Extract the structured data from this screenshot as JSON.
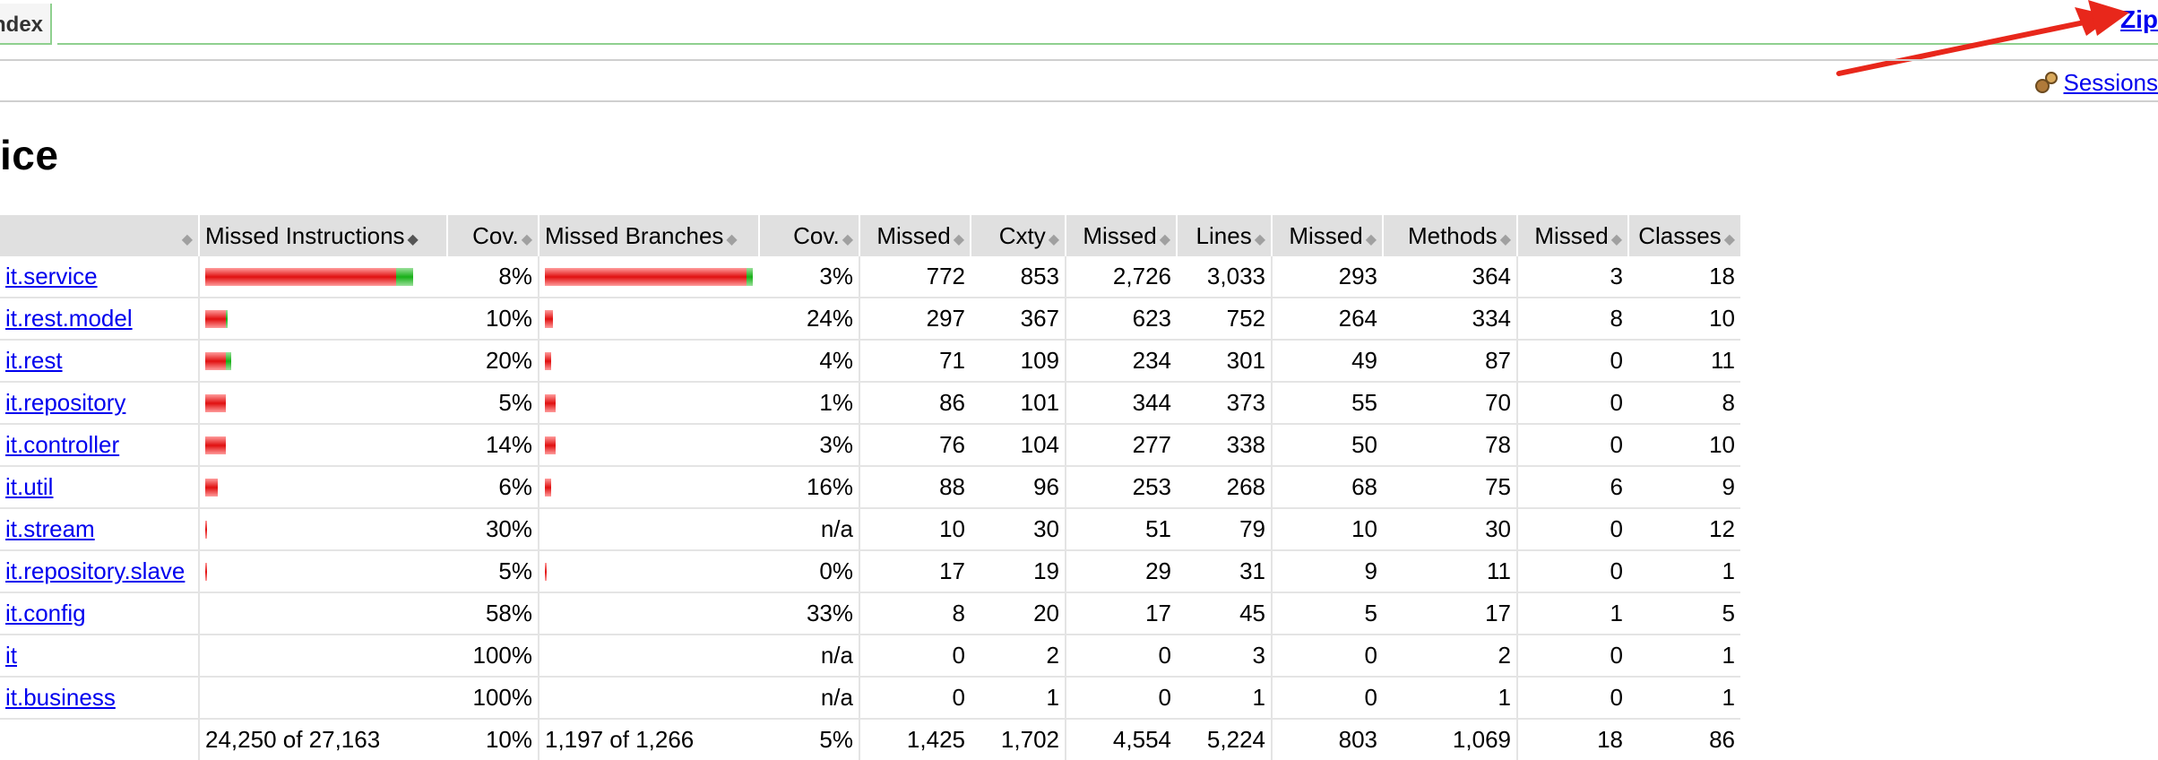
{
  "header": {
    "tab_label": "ndex",
    "zip_link": "Zip",
    "sessions_link": "Sessions"
  },
  "title": "ice",
  "table": {
    "columns": [
      "",
      "Missed Instructions",
      "Cov.",
      "Missed Branches",
      "Cov.",
      "Missed",
      "Cxty",
      "Missed",
      "Lines",
      "Missed",
      "Methods",
      "Missed",
      "Classes"
    ],
    "rows": [
      {
        "name": "it.service",
        "ins_red": 0.92,
        "ins_green": 0.08,
        "ins_cov": "8%",
        "br_red": 0.97,
        "br_green": 0.03,
        "br_cov": "3%",
        "cx_missed": "772",
        "cxty": "853",
        "ln_missed": "2,726",
        "lines": "3,033",
        "mt_missed": "293",
        "methods": "364",
        "cl_missed": "3",
        "classes": "18"
      },
      {
        "name": "it.rest.model",
        "ins_red": 0.1,
        "ins_green": 0.01,
        "ins_cov": "10%",
        "br_red": 0.04,
        "br_green": 0.0,
        "br_cov": "24%",
        "cx_missed": "297",
        "cxty": "367",
        "ln_missed": "623",
        "lines": "752",
        "mt_missed": "264",
        "methods": "334",
        "cl_missed": "8",
        "classes": "10"
      },
      {
        "name": "it.rest",
        "ins_red": 0.1,
        "ins_green": 0.025,
        "ins_cov": "20%",
        "br_red": 0.03,
        "br_green": 0.0,
        "br_cov": "4%",
        "cx_missed": "71",
        "cxty": "109",
        "ln_missed": "234",
        "lines": "301",
        "mt_missed": "49",
        "methods": "87",
        "cl_missed": "0",
        "classes": "11"
      },
      {
        "name": "it.repository",
        "ins_red": 0.1,
        "ins_green": 0.0,
        "ins_cov": "5%",
        "br_red": 0.05,
        "br_green": 0.0,
        "br_cov": "1%",
        "cx_missed": "86",
        "cxty": "101",
        "ln_missed": "344",
        "lines": "373",
        "mt_missed": "55",
        "methods": "70",
        "cl_missed": "0",
        "classes": "8"
      },
      {
        "name": "it.controller",
        "ins_red": 0.1,
        "ins_green": 0.0,
        "ins_cov": "14%",
        "br_red": 0.05,
        "br_green": 0.0,
        "br_cov": "3%",
        "cx_missed": "76",
        "cxty": "104",
        "ln_missed": "277",
        "lines": "338",
        "mt_missed": "50",
        "methods": "78",
        "cl_missed": "0",
        "classes": "10"
      },
      {
        "name": "it.util",
        "ins_red": 0.06,
        "ins_green": 0.0,
        "ins_cov": "6%",
        "br_red": 0.03,
        "br_green": 0.0,
        "br_cov": "16%",
        "cx_missed": "88",
        "cxty": "96",
        "ln_missed": "253",
        "lines": "268",
        "mt_missed": "68",
        "methods": "75",
        "cl_missed": "6",
        "classes": "9"
      },
      {
        "name": "it.stream",
        "ins_red": 0.01,
        "ins_green": 0.0,
        "ins_cov": "30%",
        "br_red": 0.0,
        "br_green": 0.0,
        "br_cov": "n/a",
        "cx_missed": "10",
        "cxty": "30",
        "ln_missed": "51",
        "lines": "79",
        "mt_missed": "10",
        "methods": "30",
        "cl_missed": "0",
        "classes": "12"
      },
      {
        "name": "it.repository.slave",
        "ins_red": 0.01,
        "ins_green": 0.0,
        "ins_cov": "5%",
        "br_red": 0.01,
        "br_green": 0.0,
        "br_cov": "0%",
        "cx_missed": "17",
        "cxty": "19",
        "ln_missed": "29",
        "lines": "31",
        "mt_missed": "9",
        "methods": "11",
        "cl_missed": "0",
        "classes": "1"
      },
      {
        "name": "it.config",
        "ins_red": 0.0,
        "ins_green": 0.0,
        "ins_cov": "58%",
        "br_red": 0.0,
        "br_green": 0.0,
        "br_cov": "33%",
        "cx_missed": "8",
        "cxty": "20",
        "ln_missed": "17",
        "lines": "45",
        "mt_missed": "5",
        "methods": "17",
        "cl_missed": "1",
        "classes": "5"
      },
      {
        "name": "it",
        "ins_red": 0.0,
        "ins_green": 0.0,
        "ins_cov": "100%",
        "br_red": 0.0,
        "br_green": 0.0,
        "br_cov": "n/a",
        "cx_missed": "0",
        "cxty": "2",
        "ln_missed": "0",
        "lines": "3",
        "mt_missed": "0",
        "methods": "2",
        "cl_missed": "0",
        "classes": "1"
      },
      {
        "name": "it.business",
        "ins_red": 0.0,
        "ins_green": 0.0,
        "ins_cov": "100%",
        "br_red": 0.0,
        "br_green": 0.0,
        "br_cov": "n/a",
        "cx_missed": "0",
        "cxty": "1",
        "ln_missed": "0",
        "lines": "1",
        "mt_missed": "0",
        "methods": "1",
        "cl_missed": "0",
        "classes": "1"
      }
    ],
    "total": {
      "ins": "24,250 of 27,163",
      "ins_cov": "10%",
      "br": "1,197 of 1,266",
      "br_cov": "5%",
      "cx_missed": "1,425",
      "cxty": "1,702",
      "ln_missed": "4,554",
      "lines": "5,224",
      "mt_missed": "803",
      "methods": "1,069",
      "cl_missed": "18",
      "classes": "86"
    }
  },
  "colors": {
    "link": "#0000ee",
    "missed_bar": "#e01010",
    "covered_bar": "#17b017",
    "tab_border": "#8fd08f",
    "arrow": "#e8271b"
  },
  "icons": {
    "sessions": "sessions-icon",
    "sort": "sort-icon",
    "annotation": "red-arrow"
  }
}
